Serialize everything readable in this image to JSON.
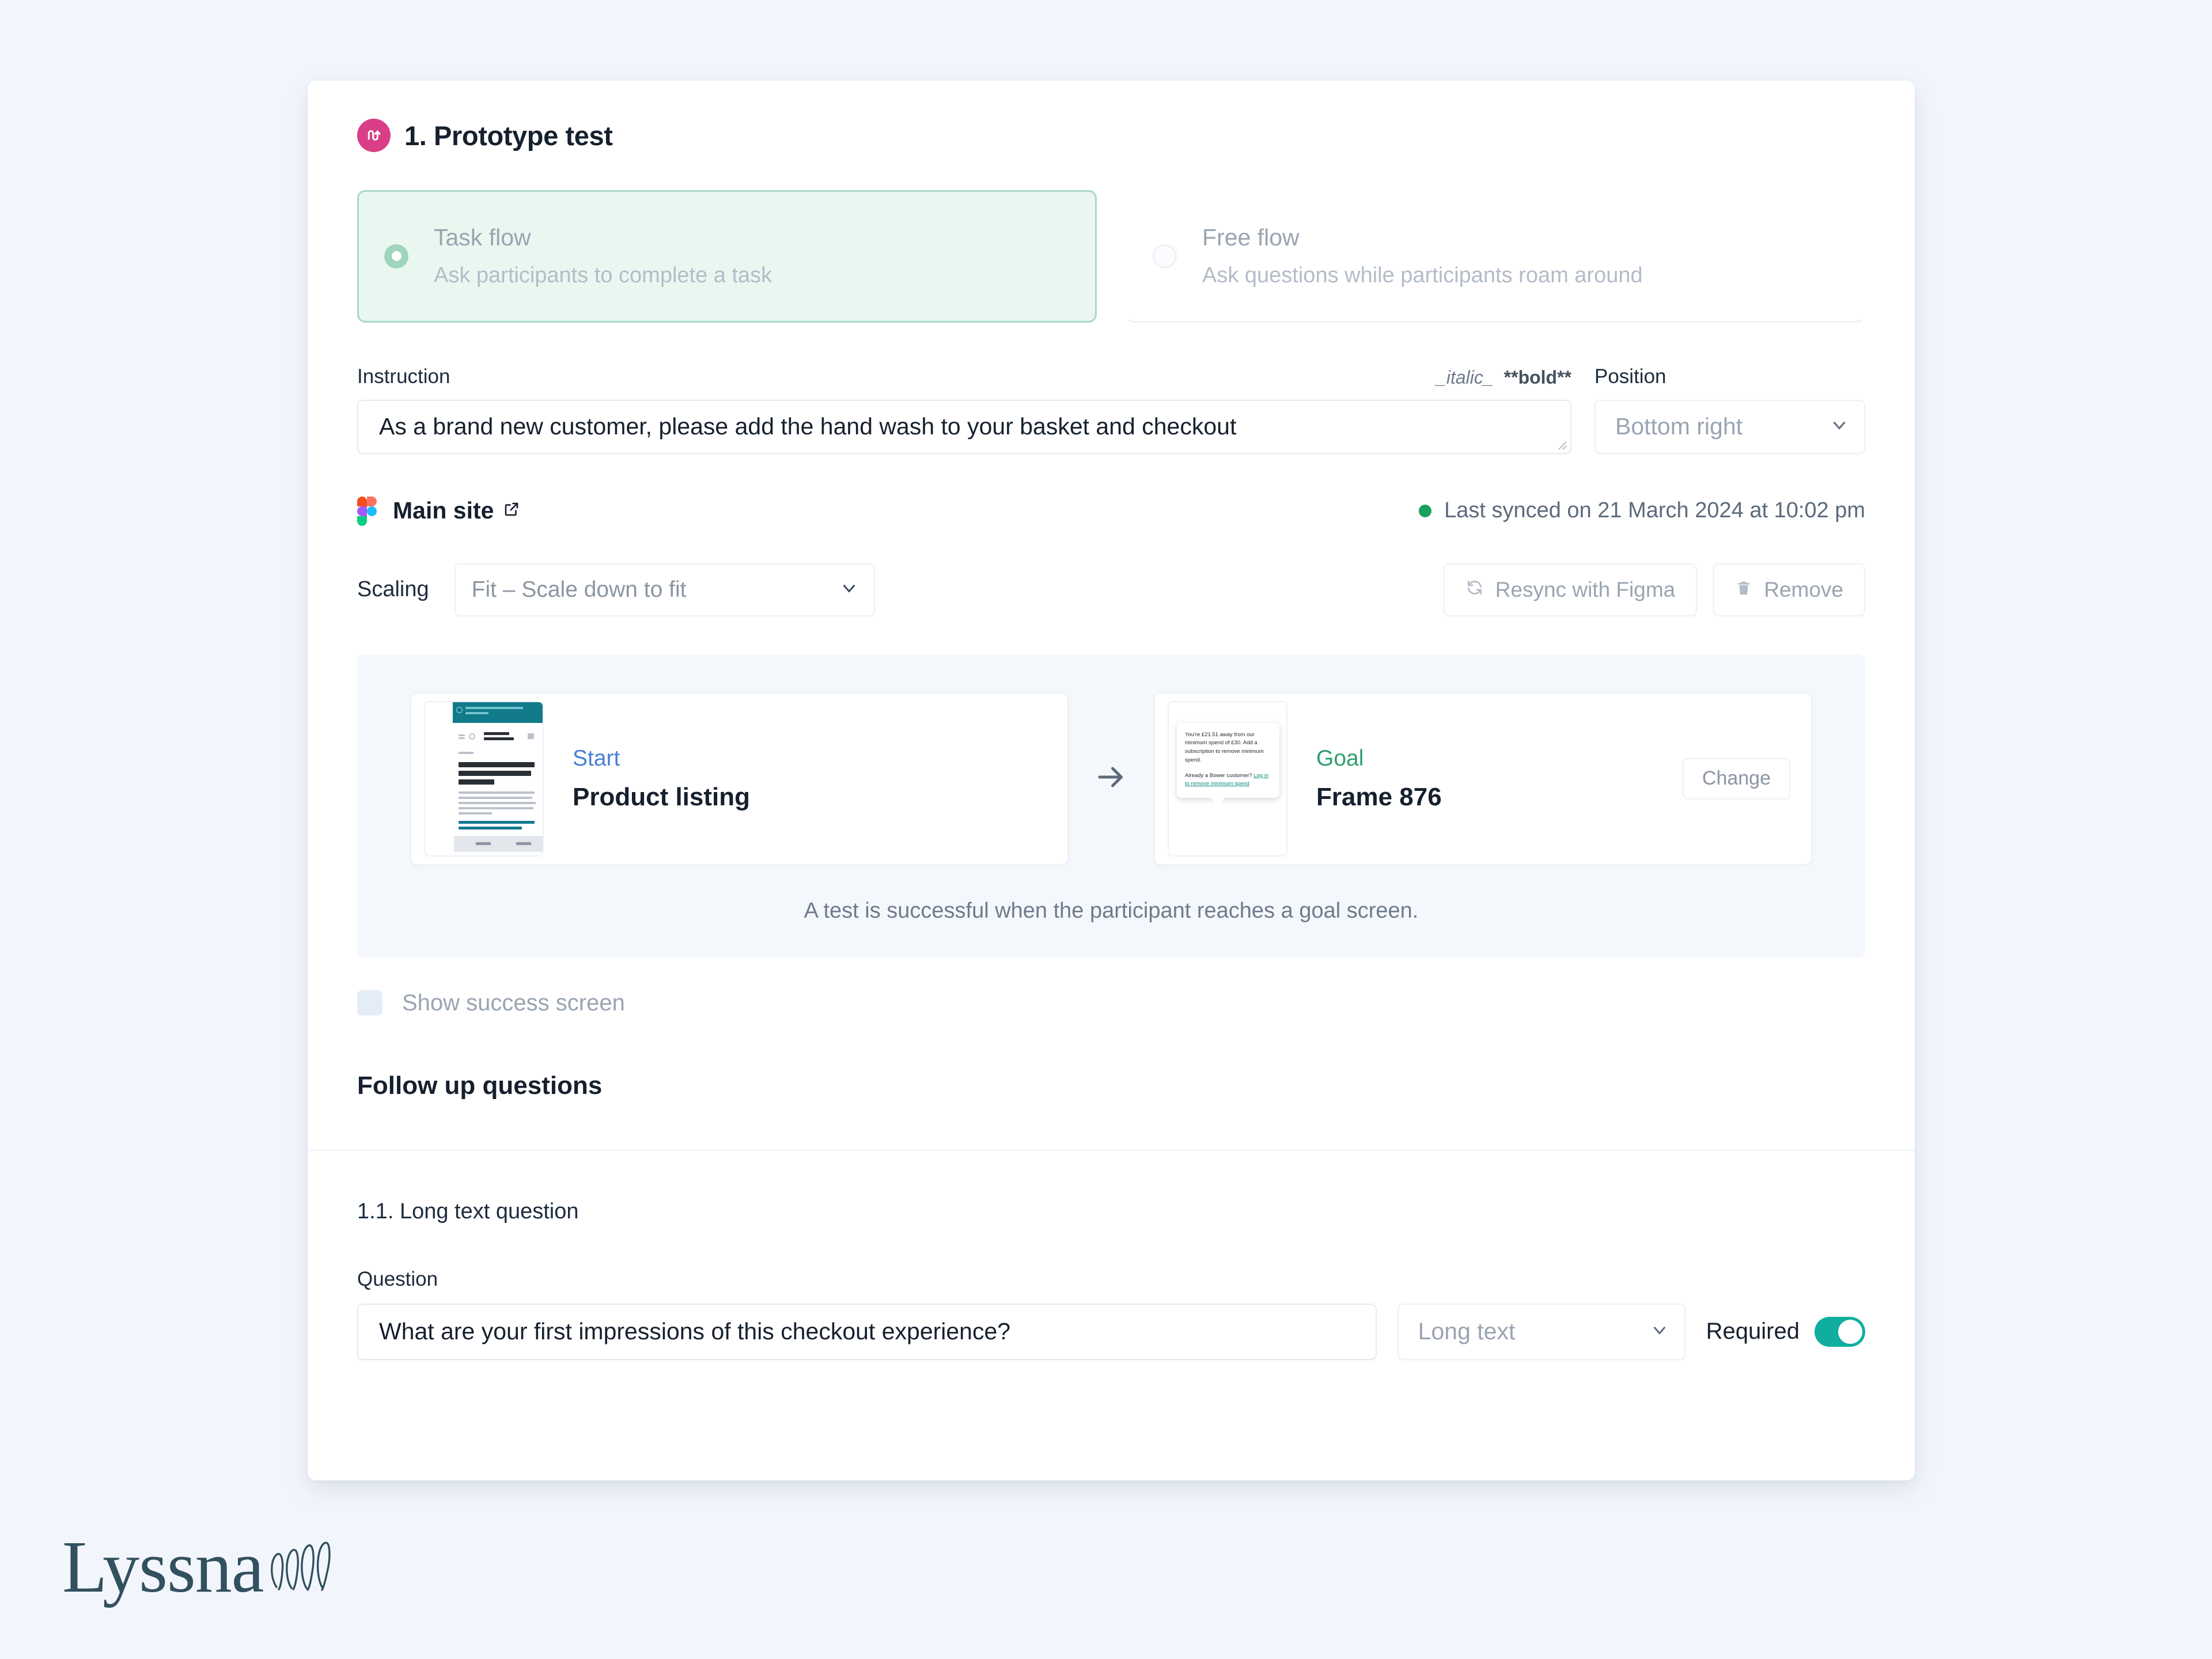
{
  "header": {
    "title": "1. Prototype test",
    "badge_icon": "prototype-flow-icon",
    "badge_color": "#d83f87"
  },
  "flow_types": {
    "options": [
      {
        "label": "Task flow",
        "description": "Ask participants to complete a task",
        "selected": true
      },
      {
        "label": "Free flow",
        "description": "Ask questions while participants roam around",
        "selected": false
      }
    ],
    "selected_bg": "#eaf7f0",
    "selected_border": "#a9d9c3"
  },
  "instruction": {
    "label": "Instruction",
    "value": "As a brand new customer, please add the hand wash to your basket and checkout",
    "format_hint_italic": "_italic_",
    "format_hint_bold": "**bold**",
    "position_label": "Position",
    "position_value": "Bottom right"
  },
  "figma": {
    "file_name": "Main site",
    "external_link_icon": "external-link-icon",
    "logo_icon": "figma-logo-icon",
    "status_dot_color": "#19a05c",
    "sync_text": "Last synced on 21 March 2024 at 10:02 pm"
  },
  "scaling": {
    "label": "Scaling",
    "value": "Fit – Scale down to fit",
    "resync_label": "Resync with Figma",
    "resync_icon": "refresh-icon",
    "remove_label": "Remove",
    "remove_icon": "trash-icon"
  },
  "flow_preview": {
    "start": {
      "kind": "Start",
      "kind_color": "#4a7fd6",
      "name": "Product listing",
      "thumbnail_alt": "product-listing-screen-thumbnail",
      "thumb_texts": {
        "banner": "10% off your first order. Use code: NEW10",
        "breadcrumb": "Home >",
        "heading": "Our Best Selling Eco Friendly Refills and Products",
        "filter": "Filter",
        "sort": "Sort",
        "cta": "Add"
      }
    },
    "goal": {
      "kind": "Goal",
      "kind_color": "#2f9e6e",
      "name": "Frame 876",
      "thumbnail_alt": "frame-876-screen-thumbnail",
      "change_label": "Change",
      "tooltip": {
        "paragraph_1": "You're £21.51 away from our minimum spend of £30. Add a subscription to remove minimum spend.",
        "paragraph_2_prefix": "Already a Bower customer? ",
        "paragraph_2_link": "Log in to remove minimum spend"
      }
    },
    "arrow_icon": "arrow-right-icon",
    "note": "A test is successful when the participant reaches a goal screen."
  },
  "success_screen": {
    "label": "Show success screen",
    "checked": false
  },
  "follow_up": {
    "heading": "Follow up questions",
    "question": {
      "index_title": "1.1. Long text question",
      "field_label": "Question",
      "value": "What are your first impressions of this checkout experience?",
      "type_value": "Long text",
      "required_label": "Required",
      "required_on": true,
      "toggle_color": "#0fae9e"
    }
  },
  "branding": {
    "wordmark": "Lyssna",
    "mark_icon": "lyssna-scribble-icon",
    "color": "#32505e"
  }
}
